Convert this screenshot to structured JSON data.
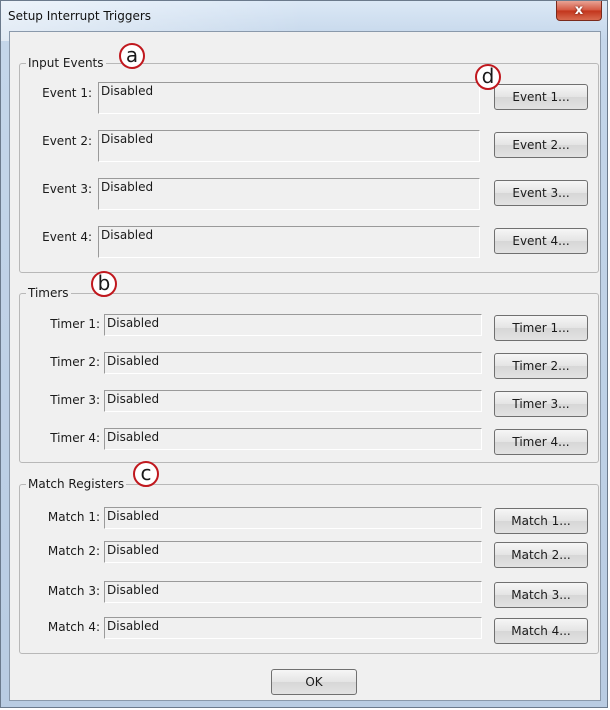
{
  "window": {
    "title": "Setup Interrupt Triggers",
    "close_glyph": "x"
  },
  "input_events": {
    "legend": "Input Events",
    "rows": [
      {
        "label": "Event 1:",
        "value": "Disabled",
        "button": "Event 1..."
      },
      {
        "label": "Event 2:",
        "value": "Disabled",
        "button": "Event 2..."
      },
      {
        "label": "Event 3:",
        "value": "Disabled",
        "button": "Event 3..."
      },
      {
        "label": "Event 4:",
        "value": "Disabled",
        "button": "Event 4..."
      }
    ]
  },
  "timers": {
    "legend": "Timers",
    "rows": [
      {
        "label": "Timer 1:",
        "value": "Disabled",
        "button": "Timer 1..."
      },
      {
        "label": "Timer 2:",
        "value": "Disabled",
        "button": "Timer 2..."
      },
      {
        "label": "Timer 3:",
        "value": "Disabled",
        "button": "Timer 3..."
      },
      {
        "label": "Timer 4:",
        "value": "Disabled",
        "button": "Timer 4..."
      }
    ]
  },
  "match_registers": {
    "legend": "Match Registers",
    "rows": [
      {
        "label": "Match 1:",
        "value": "Disabled",
        "button": "Match 1..."
      },
      {
        "label": "Match 2:",
        "value": "Disabled",
        "button": "Match 2..."
      },
      {
        "label": "Match 3:",
        "value": "Disabled",
        "button": "Match 3..."
      },
      {
        "label": "Match 4:",
        "value": "Disabled",
        "button": "Match 4..."
      }
    ]
  },
  "ok_label": "OK",
  "callouts": {
    "a": "a",
    "b": "b",
    "c": "c",
    "d": "d",
    "border_color": "#c0181e"
  }
}
